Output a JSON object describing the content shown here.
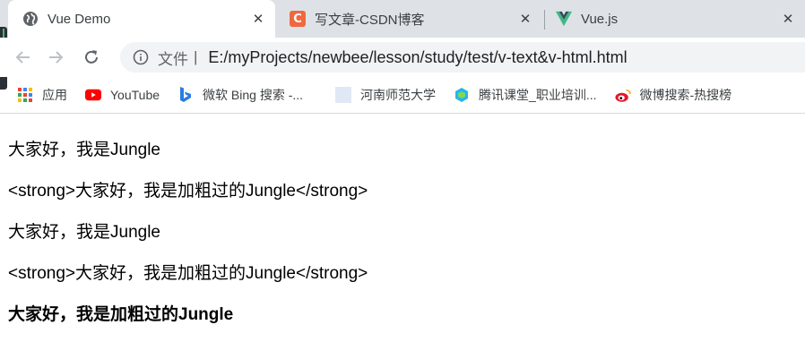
{
  "tabs": [
    {
      "title": "Vue Demo",
      "icon": "globe-icon",
      "active": true
    },
    {
      "title": "写文章-CSDN博客",
      "icon": "csdn-icon",
      "logo": "C"
    },
    {
      "title": "Vue.js",
      "icon": "vue-icon"
    }
  ],
  "tab_close_glyph": "✕",
  "toolbar": {
    "address_scheme": "文件",
    "address_pipe": "|",
    "address_url": "E:/myProjects/newbee/lesson/study/test/v-text&v-html.html"
  },
  "bookmarks": [
    {
      "label": "应用",
      "icon": "apps-grid-icon"
    },
    {
      "label": "YouTube",
      "icon": "youtube-icon"
    },
    {
      "label": "微软 Bing 搜索 -...",
      "icon": "bing-icon"
    },
    {
      "label": "河南师范大学",
      "icon": "page-placeholder-icon"
    },
    {
      "label": "腾讯课堂_职业培训...",
      "icon": "tencent-classroom-icon"
    },
    {
      "label": "微博搜索-热搜榜",
      "icon": "weibo-icon"
    }
  ],
  "content": {
    "line1": "大家好，我是Jungle",
    "line2": "<strong>大家好，我是加粗过的Jungle</strong>",
    "line3": "大家好，我是Jungle",
    "line4": "<strong>大家好，我是加粗过的Jungle</strong>",
    "line5": "大家好，我是加粗过的Jungle"
  },
  "colors": {
    "tabstrip_bg": "#dee1e6",
    "omnibox_bg": "#f1f3f4",
    "csdn": "#f1683f",
    "vue_green": "#41b883",
    "vue_dark": "#35495e",
    "youtube_red": "#ff0000"
  }
}
